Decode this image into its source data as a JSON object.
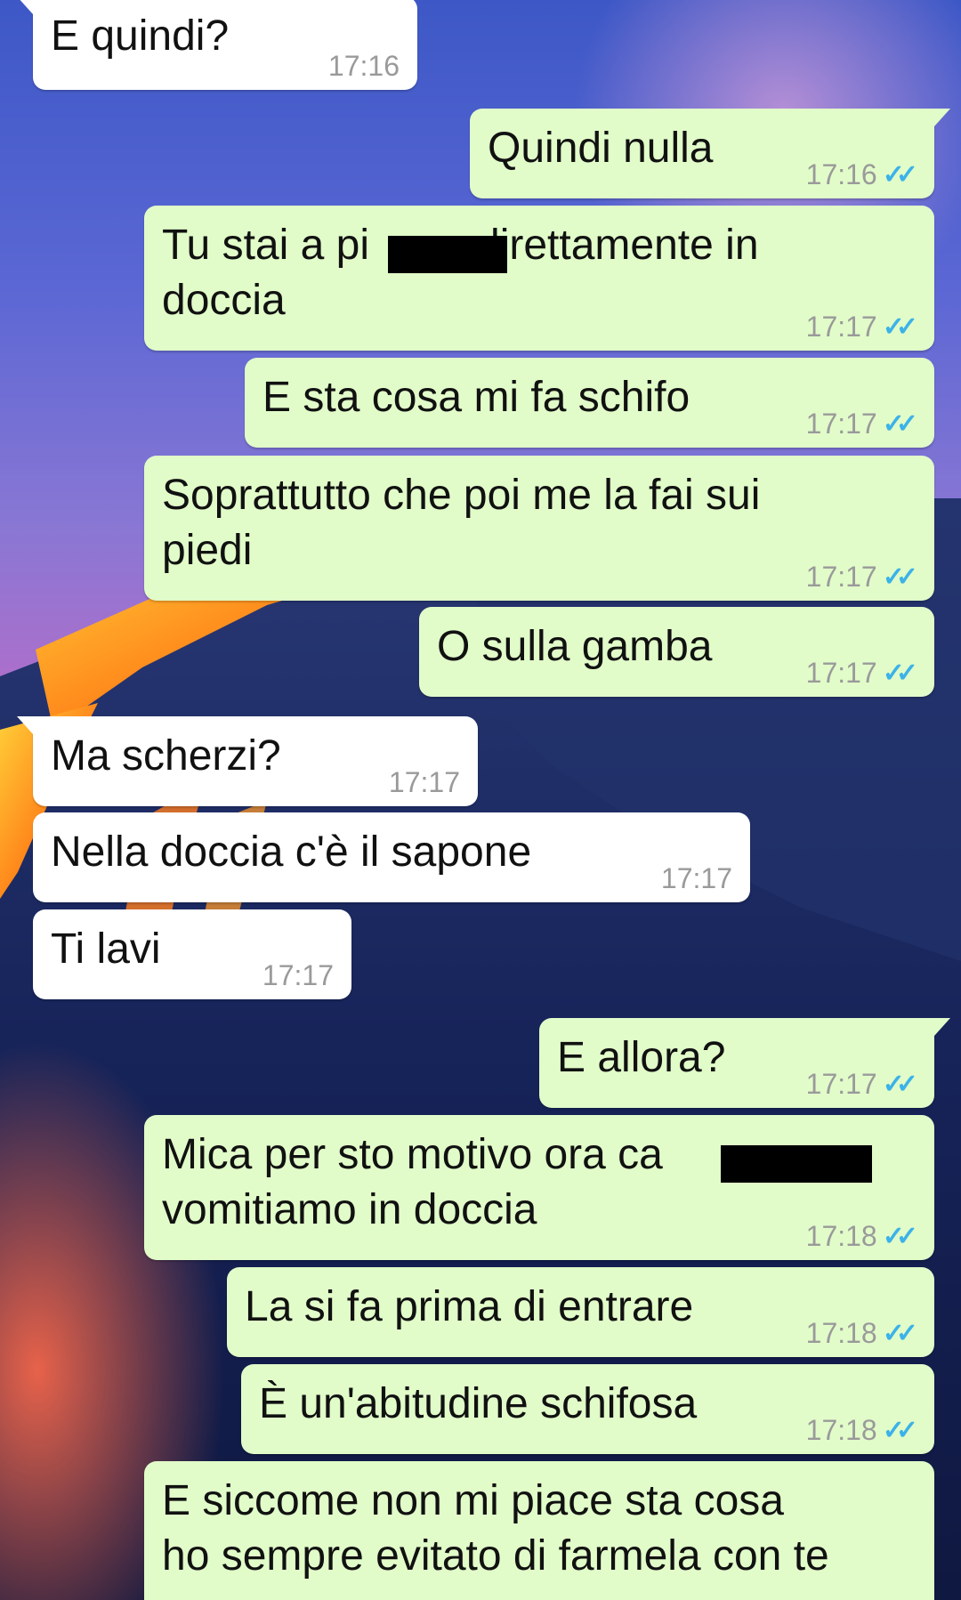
{
  "chat": {
    "messages": [
      {
        "direction": "in",
        "text": "E quindi?",
        "time": "17:16"
      },
      {
        "direction": "out",
        "text": "Quindi nulla",
        "time": "17:16",
        "status": "read-double-check-icon"
      },
      {
        "direction": "out",
        "text": "Tu stai a pi         direttamente in\ndoccia",
        "time": "17:17",
        "status": "read-double-check-icon"
      },
      {
        "direction": "out",
        "text": "E sta cosa mi fa schifo",
        "time": "17:17",
        "status": "read-double-check-icon"
      },
      {
        "direction": "out",
        "text": "Soprattutto che poi me la fai sui\npiedi",
        "time": "17:17",
        "status": "read-double-check-icon"
      },
      {
        "direction": "out",
        "text": "O sulla gamba",
        "time": "17:17",
        "status": "read-double-check-icon"
      },
      {
        "direction": "in",
        "text": "Ma scherzi?",
        "time": "17:17"
      },
      {
        "direction": "in",
        "text": "Nella doccia c'è il sapone",
        "time": "17:17"
      },
      {
        "direction": "in",
        "text": "Ti lavi",
        "time": "17:17"
      },
      {
        "direction": "out",
        "text": "E allora?",
        "time": "17:17",
        "status": "read-double-check-icon"
      },
      {
        "direction": "out",
        "text": "Mica per sto motivo ora ca              e\nvomitiamo in doccia",
        "time": "17:18",
        "status": "read-double-check-icon"
      },
      {
        "direction": "out",
        "text": "La si fa prima di entrare",
        "time": "17:18",
        "status": "read-double-check-icon"
      },
      {
        "direction": "out",
        "text": "È un'abitudine schifosa",
        "time": "17:18",
        "status": "read-double-check-icon"
      },
      {
        "direction": "out",
        "text": "E siccome non mi piace sta cosa\nho sempre evitato di farmela con te",
        "time": "",
        "status": ""
      }
    ]
  },
  "colors": {
    "incoming_bubble": "#ffffff",
    "outgoing_bubble": "#e1fcc9",
    "read_ticks": "#3cb2e8",
    "timestamp": "#9a9a9a"
  }
}
